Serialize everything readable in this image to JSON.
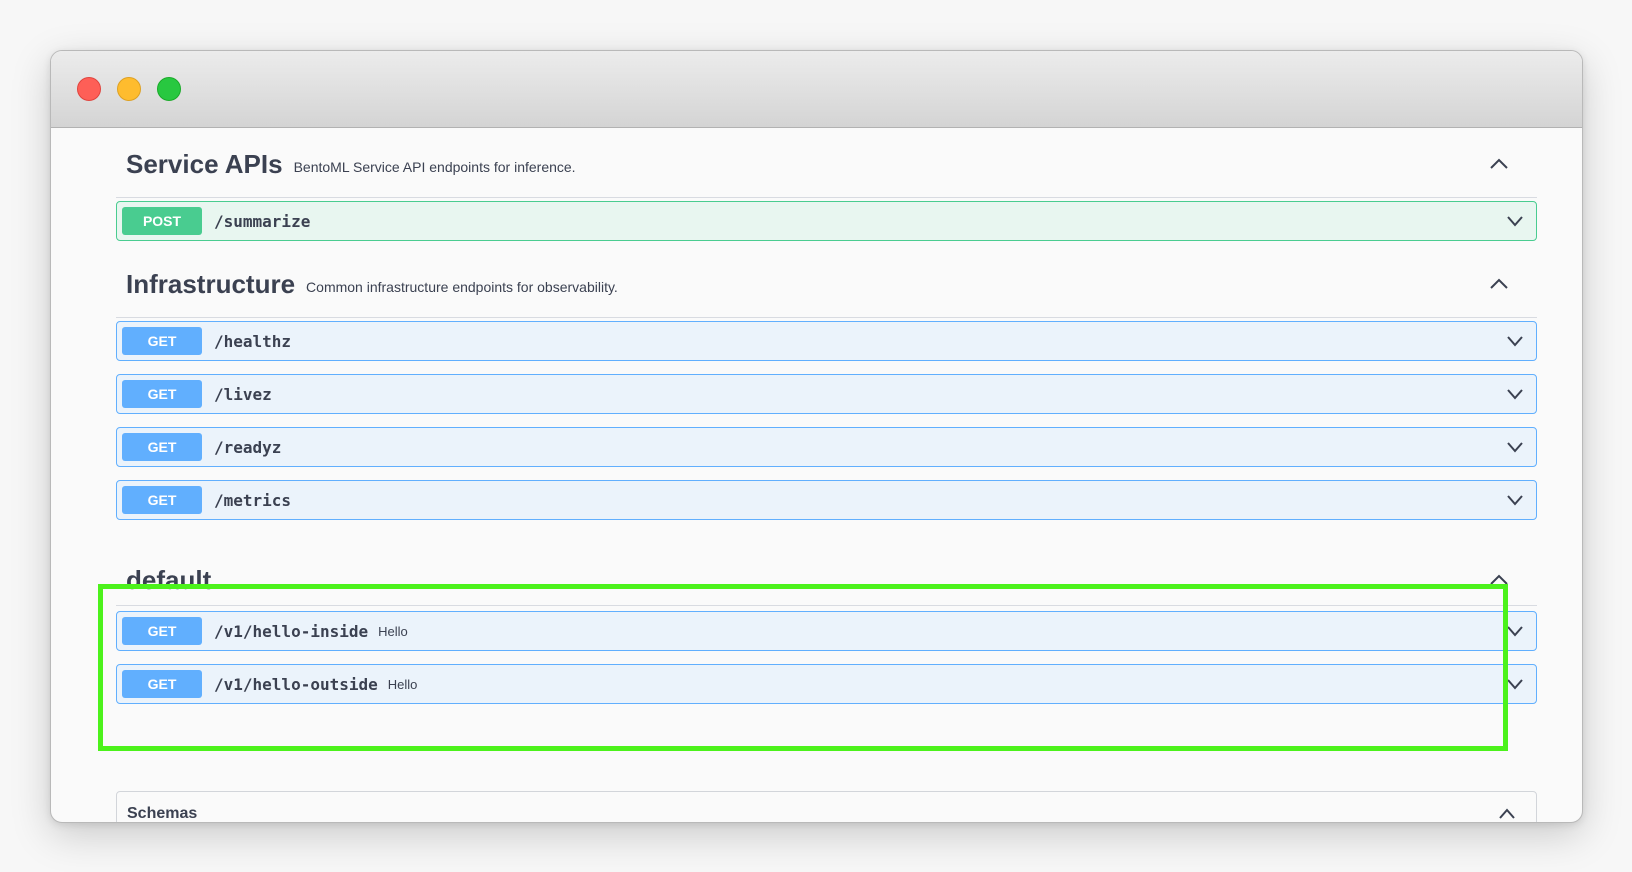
{
  "sections": [
    {
      "title": "Service APIs",
      "description": "BentoML Service API endpoints for inference.",
      "ops": [
        {
          "method": "POST",
          "path": "/summarize",
          "summary": ""
        }
      ]
    },
    {
      "title": "Infrastructure",
      "description": "Common infrastructure endpoints for observability.",
      "ops": [
        {
          "method": "GET",
          "path": "/healthz",
          "summary": ""
        },
        {
          "method": "GET",
          "path": "/livez",
          "summary": ""
        },
        {
          "method": "GET",
          "path": "/readyz",
          "summary": ""
        },
        {
          "method": "GET",
          "path": "/metrics",
          "summary": ""
        }
      ]
    },
    {
      "title": "default",
      "description": "",
      "ops": [
        {
          "method": "GET",
          "path": "/v1/hello-inside",
          "summary": "Hello"
        },
        {
          "method": "GET",
          "path": "/v1/hello-outside",
          "summary": "Hello"
        }
      ]
    }
  ],
  "schemas": {
    "title": "Schemas"
  },
  "colors": {
    "post": "#49cc90",
    "get": "#61affe",
    "highlight": "#4cf21b"
  },
  "icons": {
    "collapse": "chevron-up-icon",
    "expand": "chevron-down-icon"
  }
}
